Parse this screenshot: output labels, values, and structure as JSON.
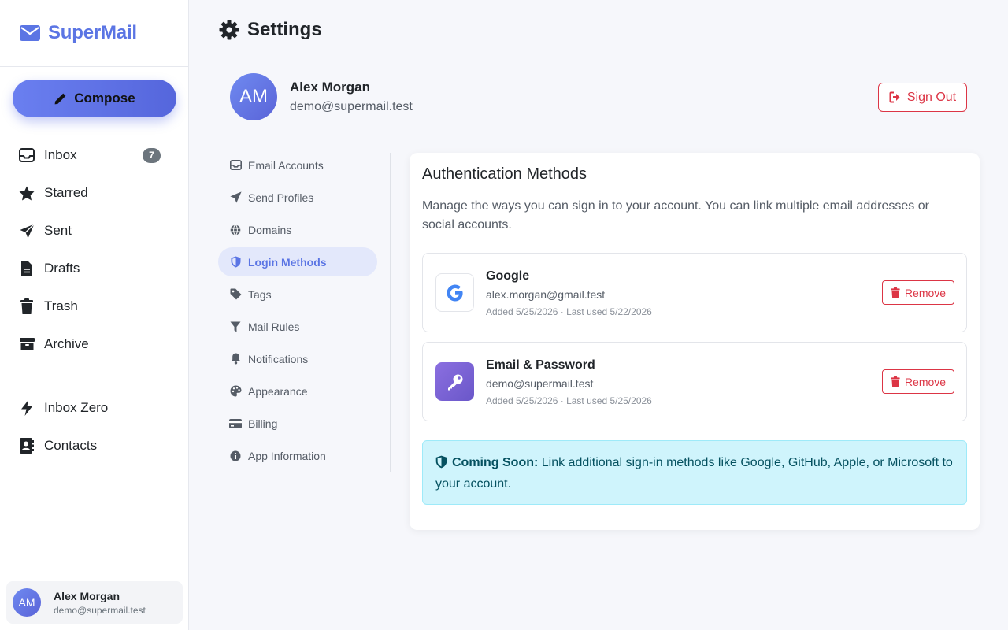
{
  "brand": {
    "name": "SuperMail"
  },
  "compose": {
    "label": "Compose"
  },
  "sidebar": {
    "items": [
      {
        "label": "Inbox",
        "icon": "inbox-icon",
        "badge": "7"
      },
      {
        "label": "Starred",
        "icon": "star-icon"
      },
      {
        "label": "Sent",
        "icon": "send-icon"
      },
      {
        "label": "Drafts",
        "icon": "file-icon"
      },
      {
        "label": "Trash",
        "icon": "trash-icon"
      },
      {
        "label": "Archive",
        "icon": "archive-icon"
      }
    ],
    "secondary": [
      {
        "label": "Inbox Zero",
        "icon": "bolt-icon"
      },
      {
        "label": "Contacts",
        "icon": "contact-book-icon"
      }
    ]
  },
  "user": {
    "initials": "AM",
    "name": "Alex Morgan",
    "email": "demo@supermail.test"
  },
  "header": {
    "title": "Settings",
    "sign_out": "Sign Out"
  },
  "settings_nav": {
    "items": [
      {
        "label": "Email Accounts",
        "icon": "inbox-icon"
      },
      {
        "label": "Send Profiles",
        "icon": "send-icon"
      },
      {
        "label": "Domains",
        "icon": "globe-icon"
      },
      {
        "label": "Login Methods",
        "icon": "shield-icon",
        "active": true
      },
      {
        "label": "Tags",
        "icon": "tag-icon"
      },
      {
        "label": "Mail Rules",
        "icon": "filter-icon"
      },
      {
        "label": "Notifications",
        "icon": "bell-icon"
      },
      {
        "label": "Appearance",
        "icon": "palette-icon"
      },
      {
        "label": "Billing",
        "icon": "credit-card-icon"
      },
      {
        "label": "App Information",
        "icon": "info-icon"
      }
    ]
  },
  "auth": {
    "title": "Authentication Methods",
    "description": "Manage the ways you can sign in to your account. You can link multiple email addresses or social accounts.",
    "methods": [
      {
        "name": "Google",
        "email": "alex.morgan@gmail.test",
        "meta": "Added 5/25/2026 · Last used 5/22/2026",
        "remove": "Remove",
        "icon": "google-icon"
      },
      {
        "name": "Email & Password",
        "email": "demo@supermail.test",
        "meta": "Added 5/25/2026 · Last used 5/25/2026",
        "remove": "Remove",
        "icon": "key-icon"
      }
    ],
    "notice": {
      "strong": "Coming Soon:",
      "text": " Link additional sign-in methods like Google, GitHub, Apple, or Microsoft to your account."
    }
  },
  "colors": {
    "accent": "#5b75e4",
    "danger": "#dc3545",
    "info_bg": "#cff4fc",
    "info_text": "#055160"
  }
}
